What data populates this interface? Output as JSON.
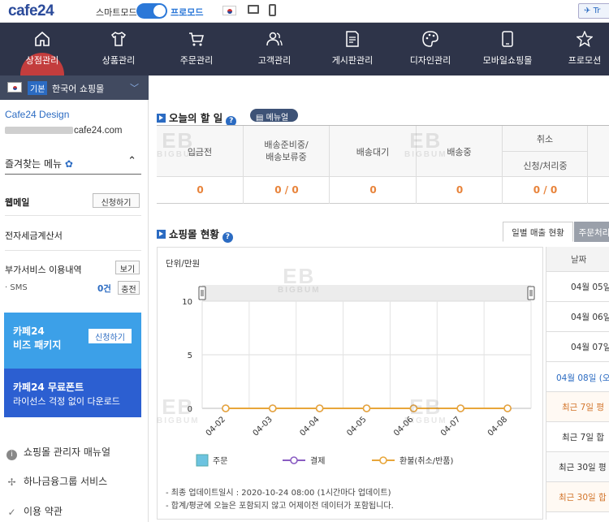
{
  "topbar": {
    "logo": "cafe24",
    "smart_mode": "스마트모드",
    "pro_mode": "프로모드",
    "translate_label": "Tr"
  },
  "nav": [
    {
      "label": "상점관리",
      "icon": "home-icon"
    },
    {
      "label": "상품관리",
      "icon": "shirt-icon"
    },
    {
      "label": "주문관리",
      "icon": "cart-icon"
    },
    {
      "label": "고객관리",
      "icon": "users-icon"
    },
    {
      "label": "게시판관리",
      "icon": "board-icon"
    },
    {
      "label": "디자인관리",
      "icon": "palette-icon"
    },
    {
      "label": "모바일쇼핑몰",
      "icon": "mobile-icon"
    },
    {
      "label": "프로모션",
      "icon": "star-icon"
    }
  ],
  "sidebar": {
    "shop_badge": "기본",
    "shop_name": "한국어 쇼핑몰",
    "design_name": "Cafe24 Design",
    "url_suffix": "cafe24.com",
    "favorites_label": "즐겨찾는 메뉴",
    "webmail_label": "웹메일",
    "webmail_btn": "신청하기",
    "tax_invoice": "전자세금계산서",
    "addon_label": "부가서비스 이용내역",
    "addon_btn": "보기",
    "sms_label": "· SMS",
    "sms_count": "0건",
    "sms_btn": "충전",
    "biz_title": "카페24",
    "biz_sub": "비즈 패키지",
    "biz_btn": "신청하기",
    "font_title": "카페24 무료폰트",
    "font_sub": "라이선스 걱정 없이 다운로드",
    "links": [
      "쇼핑몰 관리자 매뉴얼",
      "하나금융그룹 서비스",
      "이용 약관"
    ]
  },
  "todo": {
    "title": "오늘의 할 일",
    "manual_btn": "메뉴얼",
    "headers": [
      "입금전",
      "배송준비중/\n배송보류중",
      "배송대기",
      "배송중",
      "취소"
    ],
    "cancel_sub": "신청/처리중",
    "values": [
      "0",
      "0 / 0",
      "0",
      "0",
      "0 / 0"
    ]
  },
  "status": {
    "title": "쇼핑몰 현황",
    "tab_active": "일별 매출 현황",
    "tab_other": "주문처리",
    "unit": "단위/만원",
    "notes": [
      "- 최종 업데이트일시 : 2020-10-24 08:00 (1시간마다 업데이트)",
      "- 합계/평균에 오늘은 포함되지 않고 어제이전 데이터가 포함됩니다."
    ],
    "date_header": "날짜",
    "date_rows": [
      "04월 05일",
      "04월 06일",
      "04월 07일",
      "04월 08일 (오",
      "최근 7일 평",
      "최근 7일 합",
      "최근 30일 평",
      "최근 30일 합"
    ]
  },
  "chart_data": {
    "type": "line",
    "categories": [
      "04-02",
      "04-03",
      "04-04",
      "04-05",
      "04-06",
      "04-07",
      "04-08"
    ],
    "ylim": [
      0,
      10
    ],
    "yticks": [
      "10",
      "5",
      "0"
    ],
    "series": [
      {
        "name": "주문",
        "values": [
          0,
          0,
          0,
          0,
          0,
          0,
          0
        ],
        "color": "#6cc3e0"
      },
      {
        "name": "결제",
        "values": [
          0,
          0,
          0,
          0,
          0,
          0,
          0
        ],
        "color": "#8a5cc2"
      },
      {
        "name": "환불(취소/반품)",
        "values": [
          0,
          0,
          0,
          0,
          0,
          0,
          0
        ],
        "color": "#e8a63a"
      }
    ]
  },
  "watermark": {
    "big": "EB",
    "small": "BIGBUM"
  },
  "colors": {
    "nav_bg": "#2e3449",
    "active": "#c33d3d",
    "accent": "#2b6bc2",
    "value": "#e8833a"
  }
}
